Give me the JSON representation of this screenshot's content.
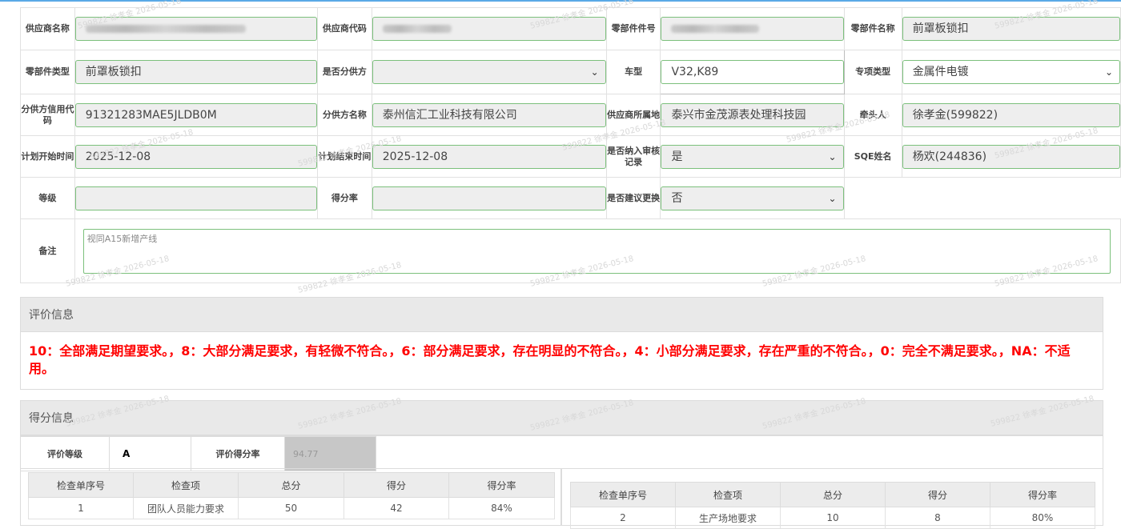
{
  "form": {
    "row1": {
      "supplier_name_label": "供应商名称",
      "supplier_code_label": "供应商代码",
      "part_no_label": "零部件件号",
      "part_name_label": "零部件名称",
      "part_name_value": "前罩板锁扣"
    },
    "row2": {
      "part_type_label": "零部件类型",
      "part_type_value": "前罩板锁扣",
      "is_sub_supplier_label": "是否分供方",
      "is_sub_supplier_value": "",
      "vehicle_label": "车型",
      "vehicle_value": "V32,K89",
      "special_type_label": "专项类型",
      "special_type_value": "金属件电镀"
    },
    "row3": {
      "sub_credit_label": "分供方信用代码",
      "sub_credit_value": "91321283MAE5JLDB0M",
      "sub_name_label": "分供方名称",
      "sub_name_value": "泰州信汇工业科技有限公司",
      "location_label": "供应商所属地",
      "location_value": "泰兴市金茂源表处理科技园",
      "lead_label": "牵头人",
      "lead_value": "徐孝金(599822)"
    },
    "row4": {
      "plan_start_label": "计划开始时间",
      "plan_start_value": "2025-12-08",
      "plan_end_label": "计划结束时间",
      "plan_end_value": "2025-12-08",
      "audit_record_label": "是否纳入审核记录",
      "audit_record_value": "是",
      "sqe_label": "SQE姓名",
      "sqe_value": "杨欢(244836)"
    },
    "row5": {
      "grade_label": "等级",
      "grade_value": "",
      "score_rate_label": "得分率",
      "score_rate_value": "",
      "replace_label": "是否建议更换",
      "replace_value": "否"
    },
    "row6": {
      "remark_label": "备注",
      "remark_value": "视同A15新增产线"
    }
  },
  "evaluation": {
    "title": "评价信息",
    "criteria": "10：全部满足期望要求。，8：大部分满足要求，有轻微不符合。，6：部分满足要求，存在明显的不符合。，4：小部分满足要求，存在严重的不符合。，0：完全不满足要求。，NA：不适用。"
  },
  "scoring": {
    "title": "得分信息",
    "eval_grade_label": "评价等级",
    "eval_grade_value": "A",
    "eval_score_rate_label": "评价得分率",
    "eval_score_rate_value": "94.77",
    "columns": [
      "检查单序号",
      "检查项",
      "总分",
      "得分",
      "得分率"
    ],
    "left_rows": [
      [
        "1",
        "团队人员能力要求",
        "50",
        "42",
        "84%"
      ]
    ],
    "right_rows": [
      [
        "2",
        "生产场地要求",
        "10",
        "8",
        "80%"
      ]
    ]
  },
  "watermark": "599822 徐孝金 2026-05-18",
  "colors": {
    "accent_top": "#5aa9e6",
    "field_border": "#7cc07c",
    "criteria_red": "#ff0000"
  }
}
